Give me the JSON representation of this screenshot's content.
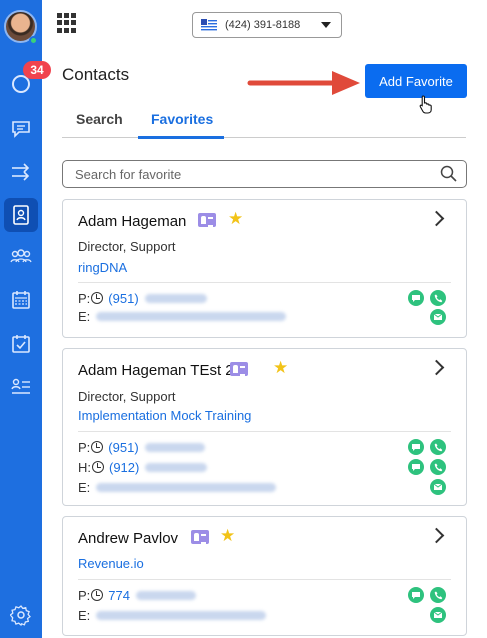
{
  "sidebar": {
    "badge_count": "34",
    "items": [
      {
        "icon": "recent-calls-icon"
      },
      {
        "icon": "messages-icon"
      },
      {
        "icon": "transfer-icon"
      },
      {
        "icon": "contacts-icon",
        "active": true
      },
      {
        "icon": "team-icon"
      },
      {
        "icon": "calendar-icon"
      },
      {
        "icon": "tasks-icon"
      },
      {
        "icon": "list-icon"
      },
      {
        "icon": "settings-icon"
      }
    ]
  },
  "header": {
    "phone_number": "(424) 391-8188"
  },
  "page": {
    "title": "Contacts",
    "add_favorite_label": "Add Favorite"
  },
  "tabs": [
    {
      "label": "Search",
      "active": false
    },
    {
      "label": "Favorites",
      "active": true
    }
  ],
  "search": {
    "placeholder": "Search for favorite"
  },
  "contacts": [
    {
      "name": "Adam Hageman",
      "title": "Director, Support",
      "company": "ringDNA",
      "phones": [
        {
          "label": "P:",
          "number": "(951)"
        }
      ],
      "email_label": "E:"
    },
    {
      "name": "Adam Hageman TEst 2",
      "title": "Director, Support",
      "company": "Implementation Mock Training",
      "phones": [
        {
          "label": "P:",
          "number": "(951)"
        },
        {
          "label": "H:",
          "number": "(912)"
        }
      ],
      "email_label": "E:"
    },
    {
      "name": "Andrew Pavlov",
      "title": "",
      "company": "Revenue.io",
      "phones": [
        {
          "label": "P:",
          "number": "774"
        }
      ],
      "email_label": "E:"
    }
  ],
  "colors": {
    "sidebar": "#1e6fe0",
    "accent": "#1a6fe0",
    "badge": "#f0434e",
    "action_green": "#2ec27e",
    "star": "#f2c318",
    "vcard": "#9c8de6"
  }
}
